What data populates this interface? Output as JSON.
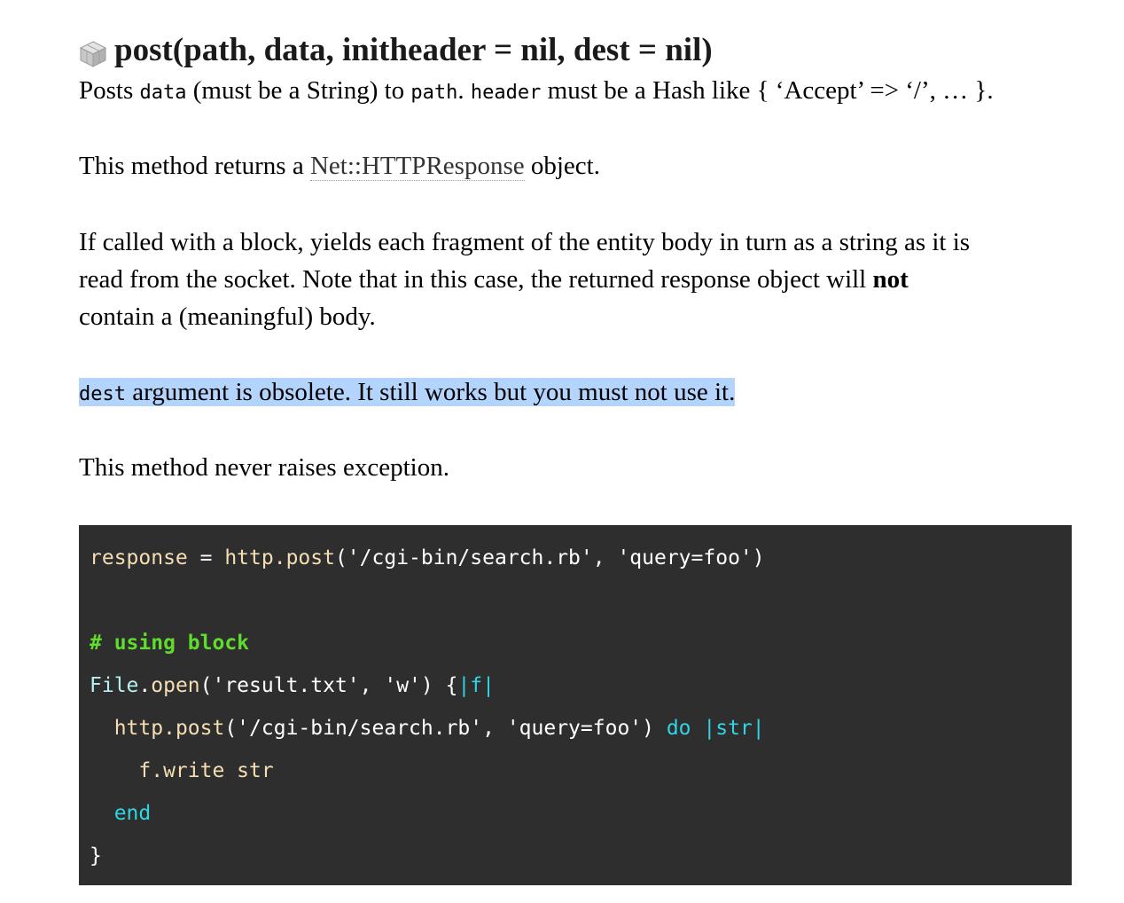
{
  "method": {
    "signature": "post(path, data, initheader = nil, dest = nil)",
    "icon": "method-cube-icon"
  },
  "paragraphs": {
    "p1": {
      "t1": "Posts ",
      "c1": "data",
      "t2": " (must be a String) to ",
      "c2": "path",
      "t3": ". ",
      "c3": "header",
      "t4": " must be a Hash like { ‘Accept’ => ‘/’, … }."
    },
    "p2": {
      "t1": "This method returns a ",
      "link": "Net::HTTPResponse",
      "t2": " object."
    },
    "p3": {
      "line1": "If called with a block, yields each fragment of the entity body in turn as a string as it is",
      "line2_pre": "read from the socket. Note that in this case, the returned response object will ",
      "line2_bold": "not",
      "line3": "contain a (meaningful) body."
    },
    "p4": {
      "c1": "dest",
      "t1": " argument is obsolete. It still works but you must not use it."
    },
    "p5": {
      "t1": "This method never raises exception."
    }
  },
  "code": {
    "l1_var": "response",
    "l1_eq": " = ",
    "l1_call": "http.post",
    "l1_args": "('/cgi-bin/search.rb', 'query=foo')",
    "l3_comment": "# using block",
    "l4_const": "File",
    "l4_dot": ".",
    "l4_meth": "open",
    "l4_args": "('result.txt', 'w') {",
    "l4_pipe": "|f|",
    "l5_indent": "  ",
    "l5_call": "http.post",
    "l5_args": "('/cgi-bin/search.rb', 'query=foo') ",
    "l5_do": "do",
    "l5_sp": " ",
    "l5_pipe": "|str|",
    "l6_indent": "    ",
    "l6_call": "f.write str",
    "l7_indent": "  ",
    "l7_end": "end",
    "l8_brace": "}"
  },
  "colors": {
    "code_background": "#2e2e2e",
    "comment": "#5fdc2c",
    "keyword": "#2ed6e4",
    "identifier": "#f5deb3",
    "selection_highlight": "#b3d4fc"
  }
}
